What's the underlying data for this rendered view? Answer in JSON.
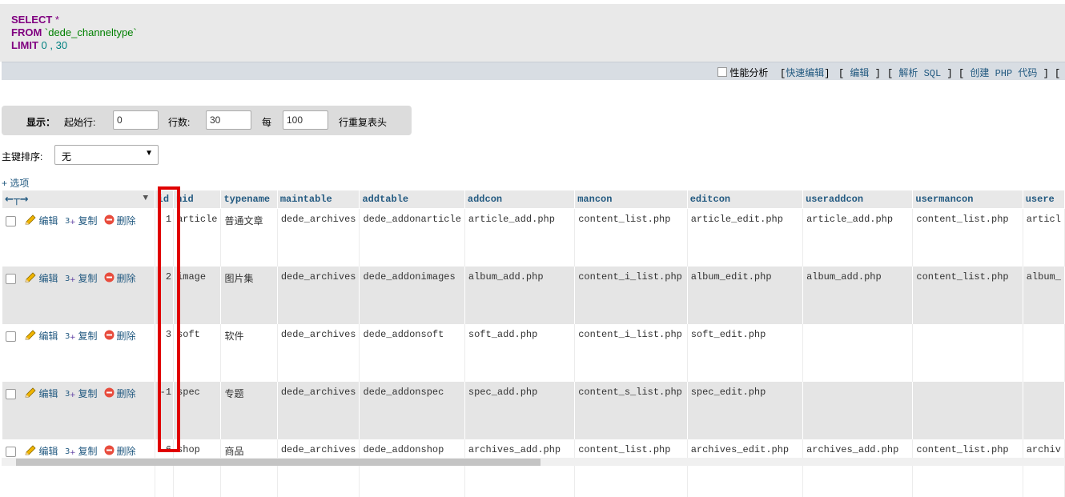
{
  "sql": {
    "line1_kw": "SELECT",
    "line1_rest": " *",
    "line2_kw": "FROM",
    "line2_rest": " `dede_channeltype`",
    "line3_kw": "LIMIT",
    "line3_num1": " 0",
    "line3_sep": " , ",
    "line3_num2": "30"
  },
  "toolbar": {
    "profiling_label": "性能分析",
    "open_bracket": "[",
    "quick_edit": "快速编辑",
    "close_bracket": "]",
    "edit": "编辑",
    "explain_sql": "解析 SQL",
    "create_php": "创建 PHP 代码"
  },
  "display": {
    "show_label": "显示：",
    "start_row_label": "起始行:",
    "start_row_value": "0",
    "rows_label": "行数:",
    "rows_value": "30",
    "per_label": "每",
    "per_value": "100",
    "repeat_header_label": "行重复表头"
  },
  "sort": {
    "label": "主键排序:",
    "selected": "无"
  },
  "options_link": "+ 选项",
  "columns": [
    "id",
    "nid",
    "typename",
    "maintable",
    "addtable",
    "addcon",
    "mancon",
    "editcon",
    "useraddcon",
    "usermancon",
    "usere"
  ],
  "actions": {
    "edit": "编辑",
    "copy": "复制",
    "delete": "删除"
  },
  "rows": [
    {
      "id": "1",
      "nid": "article",
      "typename": "普通文章",
      "maintable": "dede_archives",
      "addtable": "dede_addonarticle",
      "addcon": "article_add.php",
      "mancon": "content_list.php",
      "editcon": "article_edit.php",
      "useraddcon": "article_add.php",
      "usermancon": "content_list.php",
      "usere": "articl"
    },
    {
      "id": "2",
      "nid": "image",
      "typename": "图片集",
      "maintable": "dede_archives",
      "addtable": "dede_addonimages",
      "addcon": "album_add.php",
      "mancon": "content_i_list.php",
      "editcon": "album_edit.php",
      "useraddcon": "album_add.php",
      "usermancon": "content_list.php",
      "usere": "album_"
    },
    {
      "id": "3",
      "nid": "soft",
      "typename": "软件",
      "maintable": "dede_archives",
      "addtable": "dede_addonsoft",
      "addcon": "soft_add.php",
      "mancon": "content_i_list.php",
      "editcon": "soft_edit.php",
      "useraddcon": "",
      "usermancon": "",
      "usere": ""
    },
    {
      "id": "-1",
      "nid": "spec",
      "typename": "专题",
      "maintable": "dede_archives",
      "addtable": "dede_addonspec",
      "addcon": "spec_add.php",
      "mancon": "content_s_list.php",
      "editcon": "spec_edit.php",
      "useraddcon": "",
      "usermancon": "",
      "usere": ""
    },
    {
      "id": "6",
      "nid": "shop",
      "typename": "商品",
      "maintable": "dede_archives",
      "addtable": "dede_addonshop",
      "addcon": "archives_add.php",
      "mancon": "content_list.php",
      "editcon": "archives_edit.php",
      "useraddcon": "archives_add.php",
      "usermancon": "content_list.php",
      "usere": "archiv"
    }
  ],
  "colors": {
    "link": "#235a81",
    "keyword": "#800080",
    "highlight": "#e00000",
    "row_alt": "#e5e5e5"
  },
  "icons": [
    "pencil-icon",
    "copy-icon",
    "delete-icon",
    "column-arrows-icon",
    "sort-arrow-icon"
  ]
}
